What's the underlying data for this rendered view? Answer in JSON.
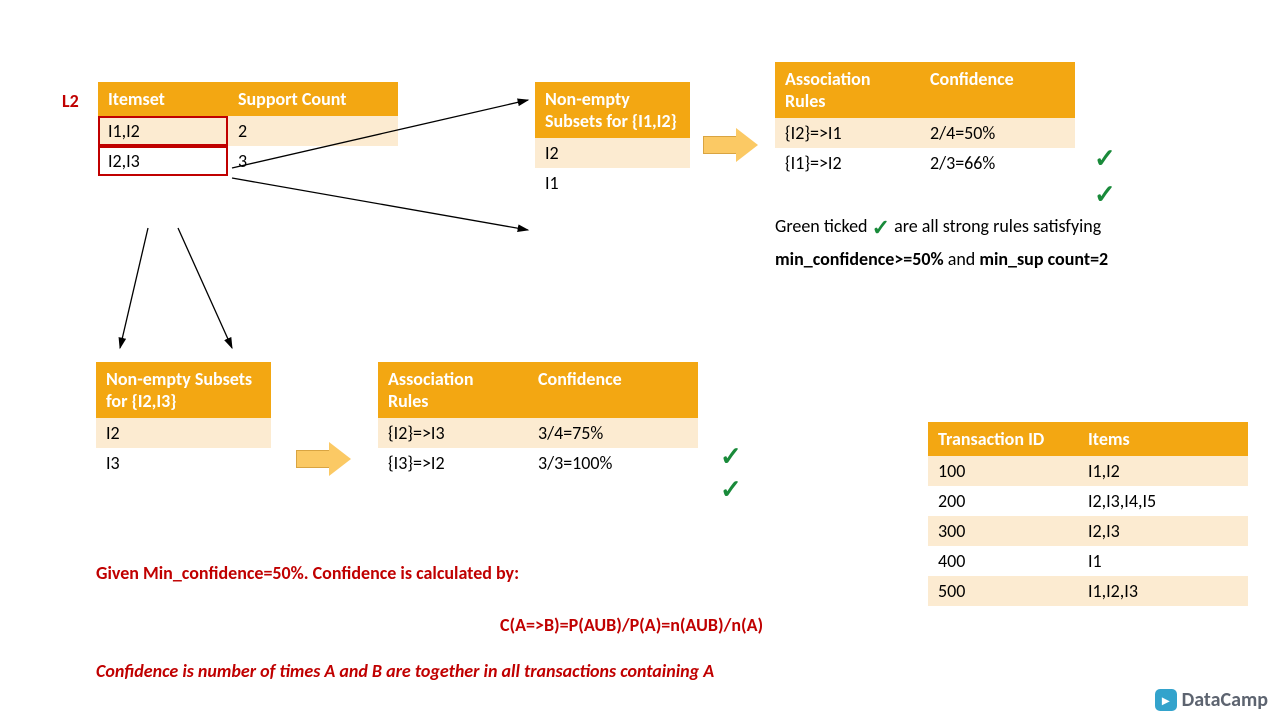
{
  "l2_label": "L2",
  "l2_table": {
    "headers": [
      "Itemset",
      "Support Count"
    ],
    "rows": [
      {
        "itemset": "I1,I2",
        "count": "2"
      },
      {
        "itemset": "I2,I3",
        "count": "3"
      }
    ]
  },
  "subsets_i1i2": {
    "header": "Non-empty Subsets for {I1,I2}",
    "rows": [
      "I2",
      "I1"
    ]
  },
  "subsets_i2i3": {
    "header": "Non-empty Subsets for {I2,I3}",
    "rows": [
      "I2",
      "I3"
    ]
  },
  "rules_top": {
    "headers": [
      "Association Rules",
      "Confidence"
    ],
    "rows": [
      {
        "rule": "{I2}=>I1",
        "conf": "2/4=50%"
      },
      {
        "rule": "{I1}=>I2",
        "conf": "2/3=66%"
      }
    ]
  },
  "rules_bottom": {
    "headers": [
      "Association Rules",
      "Confidence"
    ],
    "rows": [
      {
        "rule": "{I2}=>I3",
        "conf": "3/4=75%"
      },
      {
        "rule": "{I3}=>I2",
        "conf": "3/3=100%"
      }
    ]
  },
  "transactions": {
    "headers": [
      "Transaction ID",
      "Items"
    ],
    "rows": [
      {
        "id": "100",
        "items": "I1,I2"
      },
      {
        "id": "200",
        "items": "I2,I3,I4,I5"
      },
      {
        "id": "300",
        "items": "I2,I3"
      },
      {
        "id": "400",
        "items": "I1"
      },
      {
        "id": "500",
        "items": "I1,I2,I3"
      }
    ]
  },
  "notes": {
    "green_prefix": "Green ticked",
    "green_suffix": "are all strong rules satisfying",
    "criteria_a": "min_confidence>=50%",
    "criteria_mid": " and ",
    "criteria_b": "min_sup count=2",
    "given": "Given Min_confidence=50%. Confidence is calculated by:",
    "formula": "C(A=>B)=P(AUB)/P(A)=n(AUB)/n(A)",
    "meaning": "Confidence is number of times A and B are together in all transactions containing A"
  },
  "brand": "DataCamp",
  "check_glyph": "✓"
}
